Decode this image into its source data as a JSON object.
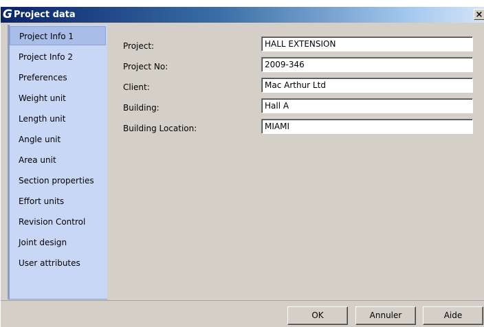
{
  "window": {
    "title": "Project data",
    "app_icon_glyph": "G",
    "close_glyph": "×"
  },
  "sidebar": {
    "items": [
      {
        "label": "Project Info 1",
        "selected": true
      },
      {
        "label": "Project Info 2",
        "selected": false
      },
      {
        "label": "Preferences",
        "selected": false
      },
      {
        "label": "Weight unit",
        "selected": false
      },
      {
        "label": "Length unit",
        "selected": false
      },
      {
        "label": "Angle unit",
        "selected": false
      },
      {
        "label": "Area unit",
        "selected": false
      },
      {
        "label": "Section properties",
        "selected": false
      },
      {
        "label": "Effort units",
        "selected": false
      },
      {
        "label": "Revision Control",
        "selected": false
      },
      {
        "label": "Joint design",
        "selected": false
      },
      {
        "label": "User attributes",
        "selected": false
      }
    ]
  },
  "form": {
    "fields": [
      {
        "label": "Project:",
        "value": "HALL EXTENSION"
      },
      {
        "label": "Project No:",
        "value": "2009-346"
      },
      {
        "label": "Client:",
        "value": "Mac Arthur Ltd"
      },
      {
        "label": "Building:",
        "value": "Hall A"
      },
      {
        "label": "Building Location:",
        "value": "MIAMI"
      }
    ]
  },
  "buttons": {
    "ok": "OK",
    "cancel": "Annuler",
    "help": "Aide"
  }
}
